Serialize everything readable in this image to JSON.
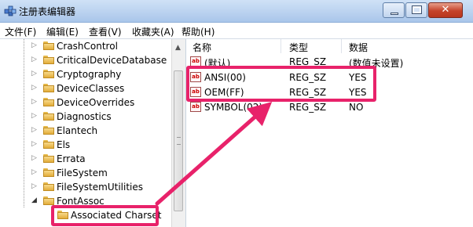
{
  "window": {
    "title": "注册表编辑器",
    "controls": {
      "minimize": "minimize",
      "maximize": "maximize",
      "close": "✕"
    }
  },
  "menu": [
    "文件(F)",
    "编辑(E)",
    "查看(V)",
    "收藏夹(A)",
    "帮助(H)"
  ],
  "tree": {
    "items": [
      {
        "label": "CrashControl",
        "expander": "▷"
      },
      {
        "label": "CriticalDeviceDatabase",
        "expander": "▷"
      },
      {
        "label": "Cryptography",
        "expander": "▷"
      },
      {
        "label": "DeviceClasses",
        "expander": "▷"
      },
      {
        "label": "DeviceOverrides",
        "expander": "▷"
      },
      {
        "label": "Diagnostics",
        "expander": "▷"
      },
      {
        "label": "Elantech",
        "expander": "▷"
      },
      {
        "label": "Els",
        "expander": "▷"
      },
      {
        "label": "Errata",
        "expander": "▷"
      },
      {
        "label": "FileSystem",
        "expander": "▷"
      },
      {
        "label": "FileSystemUtilities",
        "expander": "▷"
      },
      {
        "label": "FontAssoc",
        "expander": "◢"
      },
      {
        "label": "Associated Charset",
        "expander": ""
      }
    ]
  },
  "list": {
    "columns": [
      "名称",
      "类型",
      "数据"
    ],
    "rows": [
      {
        "name": "(默认)",
        "type": "REG_SZ",
        "data": "(数值未设置)",
        "icon": "ab"
      },
      {
        "name": "ANSI(00)",
        "type": "REG_SZ",
        "data": "YES",
        "icon": "ab"
      },
      {
        "name": "OEM(FF)",
        "type": "REG_SZ",
        "data": "YES",
        "icon": "ab"
      },
      {
        "name": "SYMBOL(02)",
        "type": "REG_SZ",
        "data": "NO",
        "icon": "ab"
      }
    ]
  },
  "colors": {
    "highlight": "#e8226a",
    "title_bar": "#b9d1ef"
  }
}
